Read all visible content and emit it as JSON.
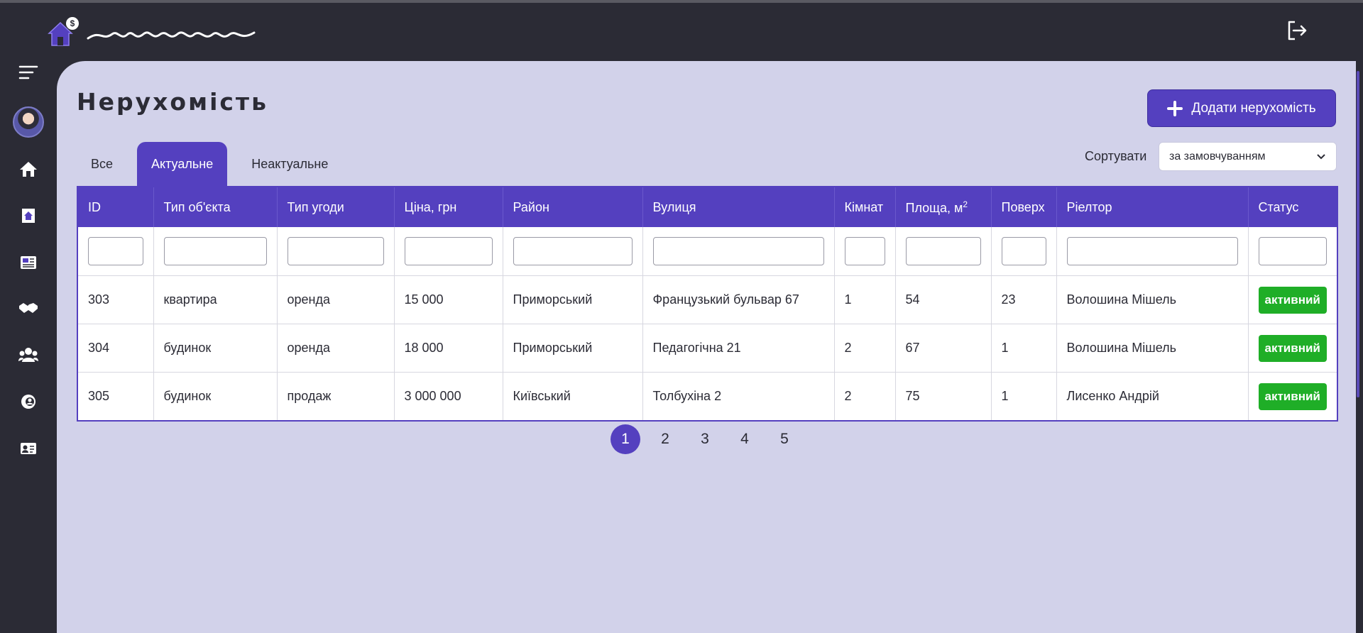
{
  "brand": {
    "badge": "$"
  },
  "nav": {
    "icons": [
      "menu-icon",
      "home-icon",
      "property-icon",
      "newspaper-icon",
      "handshake-icon",
      "users-icon",
      "settings-user-icon",
      "id-card-icon"
    ]
  },
  "page": {
    "title": "Нерухомість"
  },
  "add_button": {
    "label": "Додати нерухомість"
  },
  "tabs": [
    {
      "label": "Все",
      "active": false
    },
    {
      "label": "Актуальне",
      "active": true
    },
    {
      "label": "Неактуальне",
      "active": false
    }
  ],
  "sort": {
    "label": "Сортувати",
    "selected": "за замовчуванням"
  },
  "table": {
    "headers": [
      "ID",
      "Тип об'єкта",
      "Тип угоди",
      "Ціна, грн",
      "Район",
      "Вулиця",
      "Кімнат",
      "Площа, м",
      "Поверх",
      "Ріелтор",
      "Статус"
    ],
    "area_sup": "2",
    "rows": [
      {
        "id": "303",
        "type": "квартира",
        "deal": "оренда",
        "price": "15 000",
        "district": "Приморський",
        "street": "Французький бульвар 67",
        "rooms": "1",
        "area": "54",
        "floor": "23",
        "realtor": "Волошина Мішель",
        "status": "активний"
      },
      {
        "id": "304",
        "type": "будинок",
        "deal": "оренда",
        "price": "18 000",
        "district": "Приморський",
        "street": "Педагогічна 21",
        "rooms": "2",
        "area": "67",
        "floor": "1",
        "realtor": "Волошина Мішель",
        "status": "активний"
      },
      {
        "id": "305",
        "type": "будинок",
        "deal": "продаж",
        "price": "3 000 000",
        "district": "Київський",
        "street": "Толбухіна 2",
        "rooms": "2",
        "area": "75",
        "floor": "1",
        "realtor": "Лисенко Андрій",
        "status": "активний"
      }
    ]
  },
  "pagination": {
    "pages": [
      "1",
      "2",
      "3",
      "4",
      "5"
    ],
    "current": "1"
  },
  "colors": {
    "accent": "#5440bf",
    "dark": "#2b2b35",
    "background": "#d2d2ea",
    "status_active": "#1fae27"
  }
}
